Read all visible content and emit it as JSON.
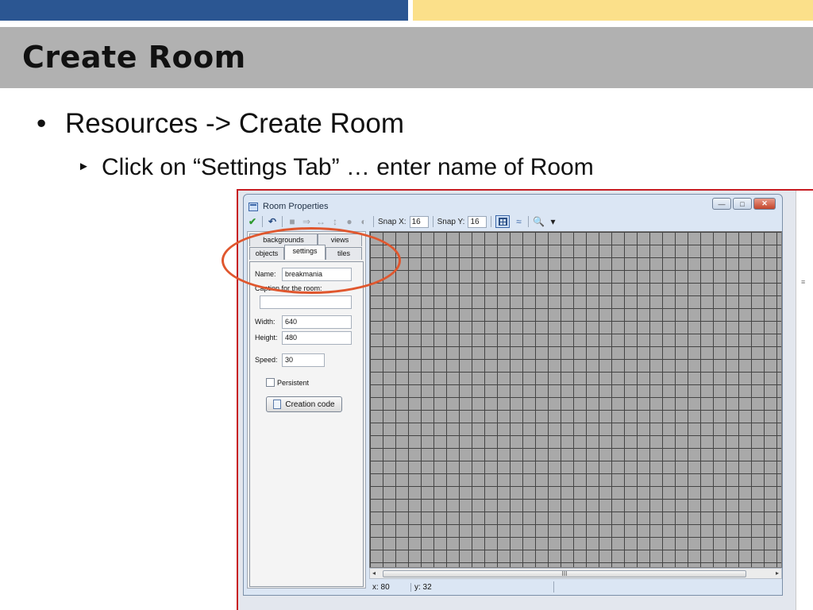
{
  "slide": {
    "title": "Create Room",
    "bullet1_marker": "•",
    "bullet1": "Resources -> Create Room",
    "bullet2_marker": "►",
    "bullet2": "Click on “Settings Tab” … enter name of Room",
    "colors": {
      "header_blue": "#2b5692",
      "header_yellow": "#fbe08a",
      "title_band": "#b1b1b1",
      "highlight": "#e0572e"
    }
  },
  "window": {
    "title": "Room Properties",
    "controls": {
      "minimize": "—",
      "maximize": "□",
      "close": "✕"
    }
  },
  "toolbar": {
    "ok_icon": "✔",
    "undo_icon": "↶",
    "snap_x_label": "Snap X:",
    "snap_x_value": "16",
    "snap_y_label": "Snap Y:",
    "snap_y_value": "16",
    "zoom_icon": "🔍",
    "dropdown_icon": "▾"
  },
  "tabs": {
    "row1": [
      "backgrounds",
      "views"
    ],
    "row2": [
      "objects",
      "settings",
      "tiles"
    ],
    "active": "settings"
  },
  "settings": {
    "name_label": "Name:",
    "name_value": "breakmania",
    "caption_label": "Caption for the room:",
    "caption_value": "",
    "width_label": "Width:",
    "width_value": "640",
    "height_label": "Height:",
    "height_value": "480",
    "speed_label": "Speed:",
    "speed_value": "30",
    "persistent_label": "Persistent",
    "persistent_checked": false,
    "creation_code_label": "Creation code"
  },
  "scrollbar": {
    "left_arrow": "◂",
    "right_arrow": "▸",
    "grip": "III"
  },
  "status": {
    "x": "x: 80",
    "y": "y: 32"
  }
}
